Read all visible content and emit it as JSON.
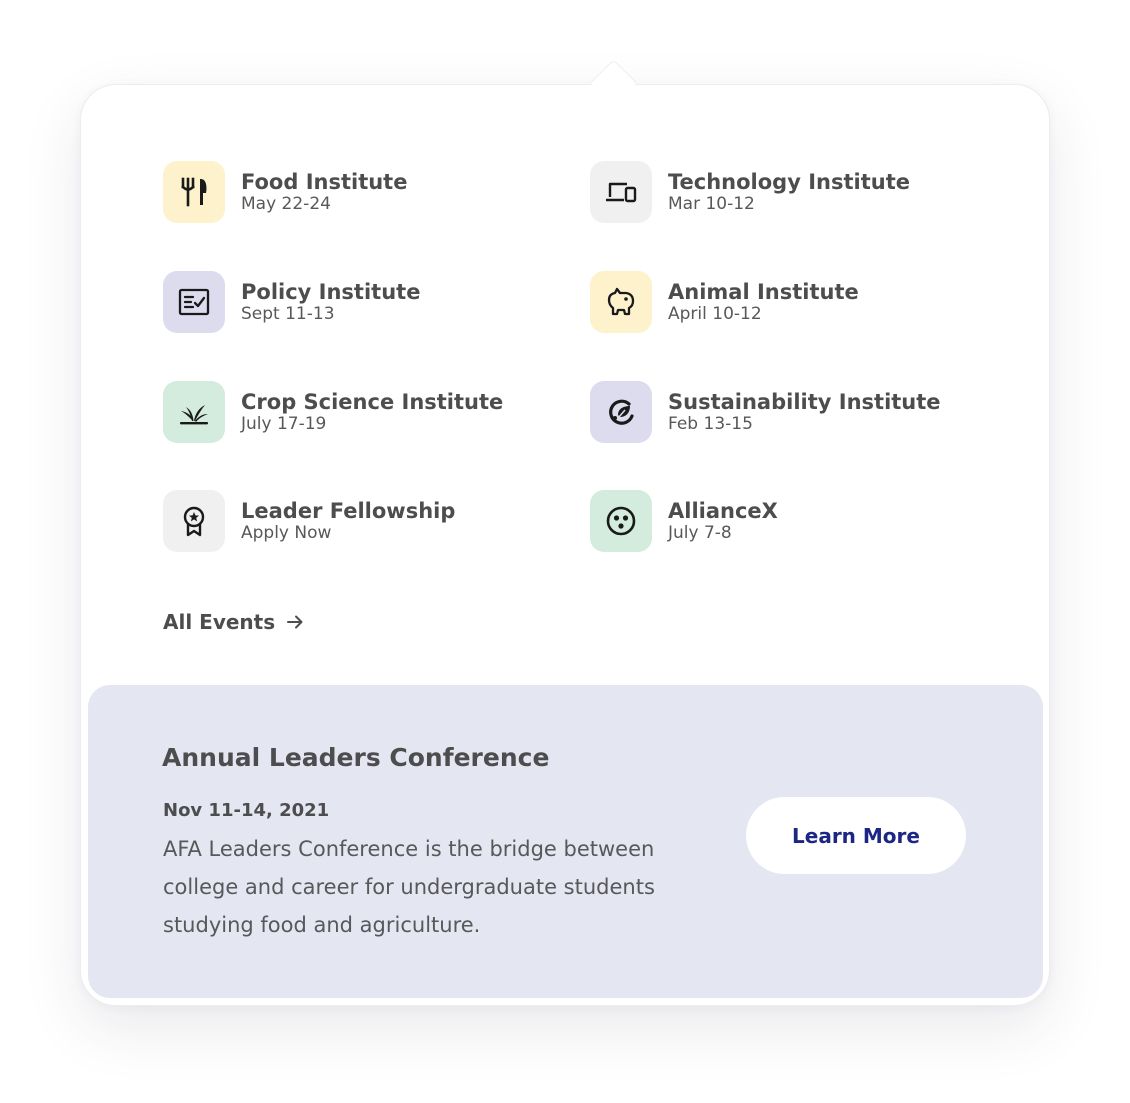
{
  "events": [
    {
      "title": "Food Institute",
      "subtitle": "May 22-24",
      "icon": "fork-knife-icon",
      "color": "#fdf2cc"
    },
    {
      "title": "Technology Institute",
      "subtitle": "Mar 10-12",
      "icon": "laptop-phone-icon",
      "color": "#f0f0f1"
    },
    {
      "title": "Policy Institute",
      "subtitle": "Sept 11-13",
      "icon": "checklist-icon",
      "color": "#dcdcee"
    },
    {
      "title": "Animal Institute",
      "subtitle": "April 10-12",
      "icon": "piggy-icon",
      "color": "#fdf2cc"
    },
    {
      "title": "Crop Science Institute",
      "subtitle": "July 17-19",
      "icon": "sprout-icon",
      "color": "#d3ecde"
    },
    {
      "title": "Sustainability Institute",
      "subtitle": "Feb 13-15",
      "icon": "recycle-leaf-icon",
      "color": "#dcdcee"
    },
    {
      "title": "Leader Fellowship",
      "subtitle": "Apply Now",
      "icon": "award-ribbon-icon",
      "color": "#f0f0f1"
    },
    {
      "title": "AllianceX",
      "subtitle": "July 7-8",
      "icon": "three-dots-circle-icon",
      "color": "#d3ecde"
    }
  ],
  "all_events_label": "All Events",
  "promo": {
    "title": "Annual Leaders Conference",
    "date": "Nov 11-14, 2021",
    "description": "AFA Leaders Conference is the bridge between college and career for undergraduate students studying food and agriculture.",
    "button_label": "Learn More",
    "button_color": "#1c2684",
    "background": "#e4e6f2"
  }
}
